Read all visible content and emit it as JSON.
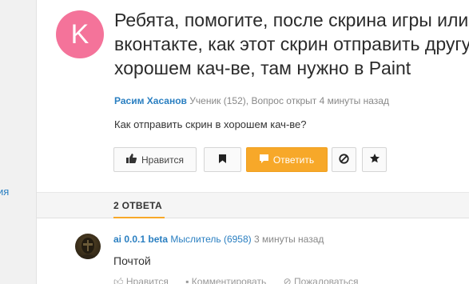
{
  "left": {
    "link_text": "ия"
  },
  "question": {
    "avatar_letter": "K",
    "title_lines": [
      "Ребята, помогите, после скрина игры или",
      "вконтакте, как этот скрин отправить другу в",
      "хорошем кач-ве, там нужно в Paint"
    ],
    "author": "Расим Хасанов",
    "rank": "Ученик",
    "rank_count": "(152),",
    "status": "Вопрос открыт 4 минуты назад",
    "body": "Как отправить скрин в хорошем кач-ве?"
  },
  "actions": {
    "like_label": "Нравится",
    "answer_label": "Ответить"
  },
  "answers_tab": {
    "label": "2 ОТВЕТА"
  },
  "answer": {
    "name": "ai 0.0.1 beta",
    "rank": "Мыслитель (6958)",
    "time": "3 минуты назад",
    "text": "Почтой",
    "actions": [
      "Нравится",
      "Комментировать",
      "Пожаловаться"
    ]
  },
  "colors": {
    "accent": "#f7a829",
    "link": "#2a7fc1",
    "avatar_bg": "#f4739a"
  }
}
